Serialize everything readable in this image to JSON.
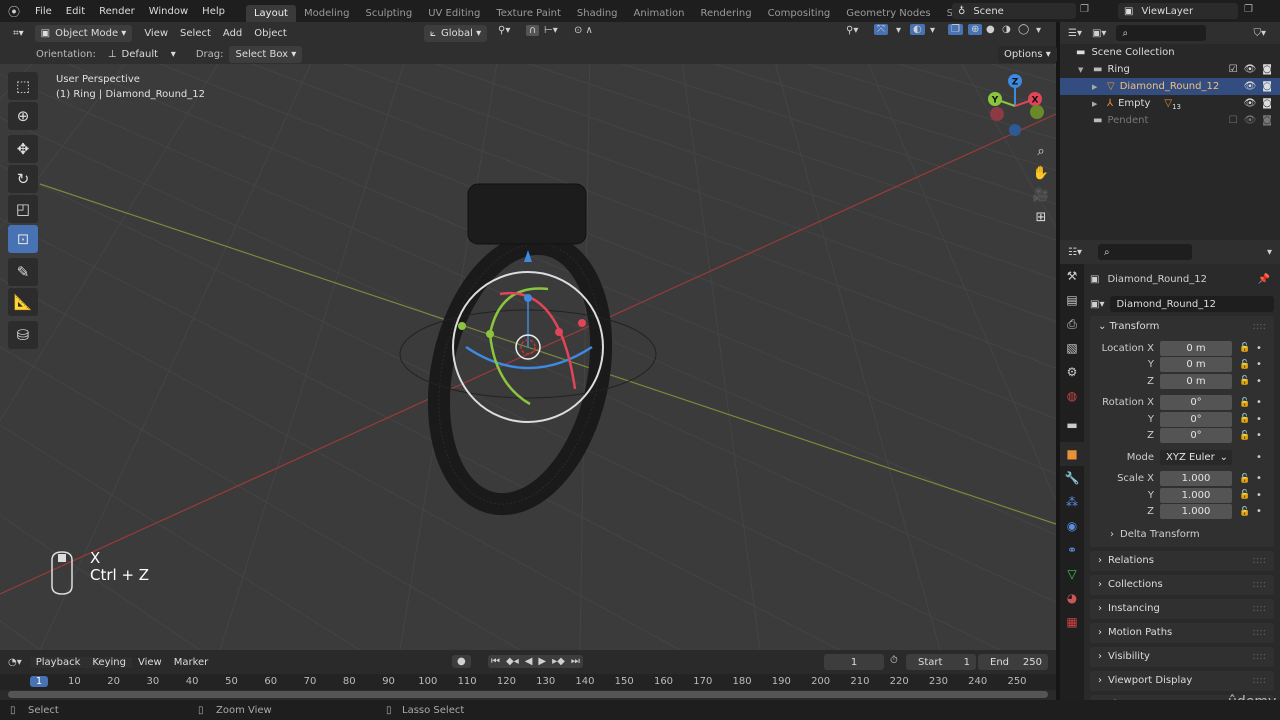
{
  "topbar": {
    "menus": [
      "File",
      "Edit",
      "Render",
      "Window",
      "Help"
    ],
    "workspaces": [
      "Layout",
      "Modeling",
      "Sculpting",
      "UV Editing",
      "Texture Paint",
      "Shading",
      "Animation",
      "Rendering",
      "Compositing",
      "Geometry Nodes",
      "Scripting"
    ],
    "active_workspace": "Layout",
    "add_label": "+",
    "scene": "Scene",
    "view_layer": "ViewLayer"
  },
  "viewport_header": {
    "mode": "Object Mode",
    "menus": [
      "View",
      "Select",
      "Add",
      "Object"
    ],
    "transform_orientation": "Global",
    "options_label": "Options"
  },
  "tool_settings": {
    "orientation_label": "Orientation:",
    "orientation_value": "Default",
    "drag_label": "Drag:",
    "drag_value": "Select Box"
  },
  "viewport": {
    "view_name": "User Perspective",
    "object_info": "(1) Ring | Diamond_Round_12",
    "keys": [
      "X",
      "Ctrl + Z"
    ],
    "axis_labels": {
      "x": "X",
      "y": "Y",
      "z": "Z"
    },
    "tools": [
      "select-box",
      "cursor",
      "move",
      "rotate",
      "scale",
      "transform",
      "annotate",
      "measure",
      "add-cube"
    ],
    "active_tool": "transform"
  },
  "outliner": {
    "root": "Scene Collection",
    "items": [
      {
        "label": "Ring",
        "level": 0,
        "type": "collection",
        "checked": true
      },
      {
        "label": "Diamond_Round_12",
        "level": 1,
        "type": "mesh",
        "selected": true
      },
      {
        "label": "Empty",
        "level": 1,
        "type": "empty",
        "badge": "13"
      },
      {
        "label": "Pendent",
        "level": 0,
        "type": "collection",
        "checked": false,
        "dimmed": true
      }
    ]
  },
  "properties": {
    "object_name": "Diamond_Round_12",
    "datablock_name": "Diamond_Round_12",
    "transform_title": "Transform",
    "location": {
      "label": "Location",
      "x": "0 m",
      "y": "0 m",
      "z": "0 m"
    },
    "rotation": {
      "label": "Rotation",
      "x": "0°",
      "y": "0°",
      "z": "0°"
    },
    "mode_label": "Mode",
    "mode_value": "XYZ Euler",
    "scale": {
      "label": "Scale",
      "x": "1.000",
      "y": "1.000",
      "z": "1.000"
    },
    "delta_transform": "Delta Transform",
    "panels": [
      "Relations",
      "Collections",
      "Instancing",
      "Motion Paths",
      "Visibility",
      "Viewport Display",
      "Line Art"
    ]
  },
  "timeline": {
    "menus": [
      "Playback",
      "Keying",
      "View",
      "Marker"
    ],
    "current_frame": "1",
    "start_label": "Start",
    "start": "1",
    "end_label": "End",
    "end": "250",
    "ticks": [
      "1",
      "10",
      "20",
      "30",
      "40",
      "50",
      "60",
      "70",
      "80",
      "90",
      "100",
      "110",
      "120",
      "130",
      "140",
      "150",
      "160",
      "170",
      "180",
      "190",
      "200",
      "210",
      "220",
      "230",
      "240",
      "250"
    ]
  },
  "status": {
    "items": [
      "Select",
      "Zoom View",
      "Lasso Select"
    ]
  },
  "watermark": "udemy",
  "colors": {
    "accent": "#4772b3",
    "selected_row": "#334d80",
    "x_axis": "#e0455a",
    "y_axis": "#8bc53f",
    "z_axis": "#3d8ae0"
  }
}
